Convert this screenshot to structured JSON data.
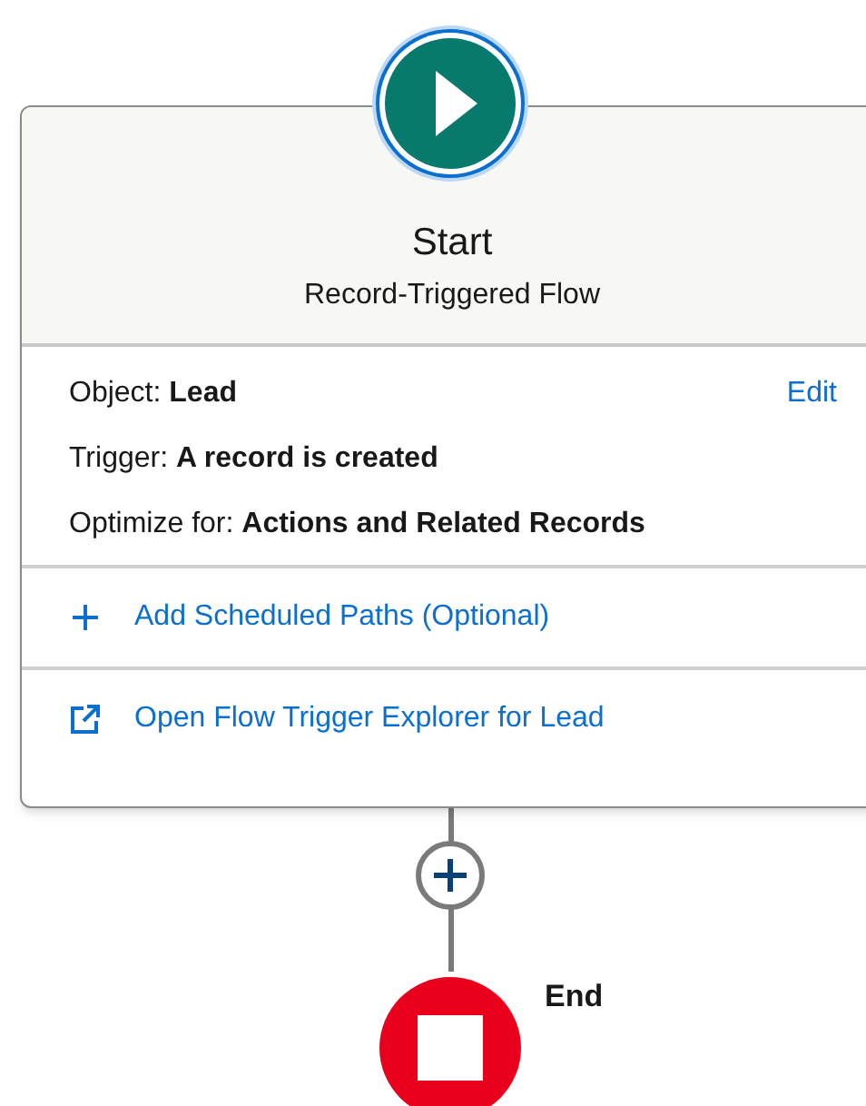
{
  "start": {
    "title": "Start",
    "subtitle": "Record-Triggered Flow"
  },
  "details": [
    {
      "label": "Object:",
      "value": "Lead"
    },
    {
      "label": "Trigger:",
      "value": "A record is created"
    },
    {
      "label": "Optimize for:",
      "value": "Actions and Related Records"
    }
  ],
  "edit_link": "Edit",
  "actions": [
    {
      "kind": "add",
      "label": "Add Scheduled Paths (Optional)"
    },
    {
      "kind": "external",
      "label": "Open Flow Trigger Explorer for Lead"
    }
  ],
  "end": {
    "label": "End"
  }
}
